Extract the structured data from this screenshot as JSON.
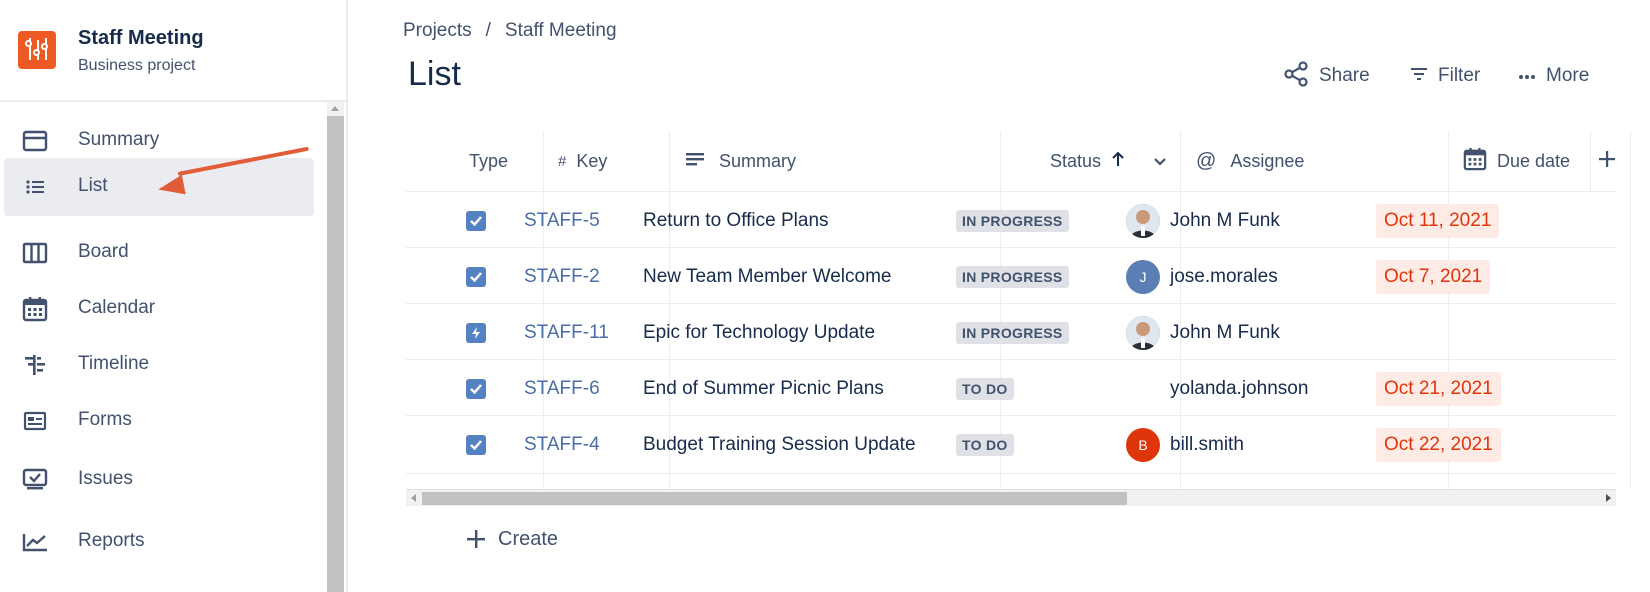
{
  "project": {
    "name": "Staff Meeting",
    "type": "Business project",
    "avatar_color": "#ee5a24"
  },
  "sidebar": {
    "items": [
      {
        "label": "Summary",
        "icon": "summary-icon"
      },
      {
        "label": "List",
        "icon": "list-icon",
        "active": true
      },
      {
        "label": "Board",
        "icon": "board-icon"
      },
      {
        "label": "Calendar",
        "icon": "calendar-icon"
      },
      {
        "label": "Timeline",
        "icon": "timeline-icon"
      },
      {
        "label": "Forms",
        "icon": "forms-icon"
      },
      {
        "label": "Issues",
        "icon": "issues-icon"
      },
      {
        "label": "Reports",
        "icon": "reports-icon"
      }
    ]
  },
  "breadcrumb": {
    "root": "Projects",
    "sep": "/",
    "current": "Staff Meeting"
  },
  "page": {
    "title": "List"
  },
  "toolbar": {
    "share": "Share",
    "filter": "Filter",
    "more": "More"
  },
  "table": {
    "columns": {
      "type": "Type",
      "key_prefix": "#",
      "key": "Key",
      "summary": "Summary",
      "status": "Status",
      "assignee_prefix": "@",
      "assignee": "Assignee",
      "due": "Due date"
    },
    "rows": [
      {
        "type": "task",
        "key": "STAFF-5",
        "summary": "Return to Office Plans",
        "status": "IN PROGRESS",
        "assignee": "John M Funk",
        "avatar": "photo",
        "due": "Oct 11, 2021"
      },
      {
        "type": "task",
        "key": "STAFF-2",
        "summary": "New Team Member Welcome",
        "status": "IN PROGRESS",
        "assignee": "jose.morales",
        "avatar": "J",
        "avatar_color": "#5b7fb5",
        "due": "Oct 7, 2021"
      },
      {
        "type": "epic",
        "key": "STAFF-11",
        "summary": "Epic for Technology Update",
        "status": "IN PROGRESS",
        "assignee": "John M Funk",
        "avatar": "photo",
        "due": ""
      },
      {
        "type": "task",
        "key": "STAFF-6",
        "summary": "End of Summer Picnic Plans",
        "status": "TO DO",
        "assignee": "yolanda.johnson",
        "avatar": "",
        "due": "Oct 21, 2021"
      },
      {
        "type": "task",
        "key": "STAFF-4",
        "summary": "Budget Training Session Update",
        "status": "TO DO",
        "assignee": "bill.smith",
        "avatar": "B",
        "avatar_color": "#de350b",
        "due": "Oct 22, 2021"
      }
    ]
  },
  "create": {
    "label": "Create"
  },
  "colors": {
    "due_bg": "#ffebe6",
    "due_text": "#de350b",
    "key_link": "#4a6da7",
    "annotation_arrow": "#e15d3a"
  }
}
